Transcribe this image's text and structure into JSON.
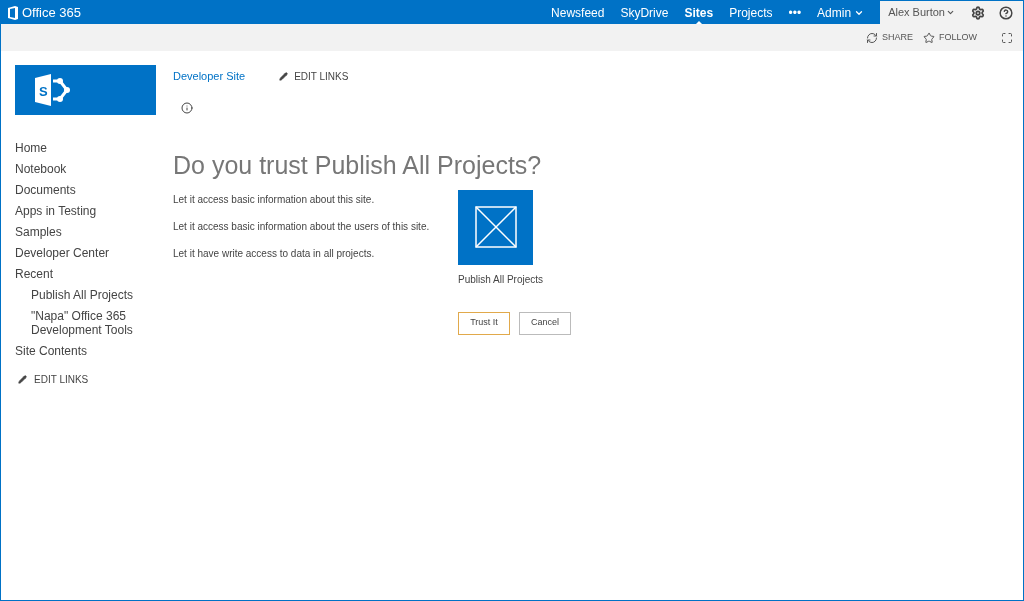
{
  "brand": "Office 365",
  "top_nav": [
    {
      "label": "Newsfeed",
      "selected": false,
      "dropdown": false
    },
    {
      "label": "SkyDrive",
      "selected": false,
      "dropdown": false
    },
    {
      "label": "Sites",
      "selected": true,
      "dropdown": false
    },
    {
      "label": "Projects",
      "selected": false,
      "dropdown": false
    },
    {
      "label": "•••",
      "selected": false,
      "dropdown": false
    },
    {
      "label": "Admin",
      "selected": false,
      "dropdown": true
    }
  ],
  "user": {
    "name": "Alex Burton"
  },
  "actions": [
    {
      "kind": "share",
      "label": "SHARE"
    },
    {
      "kind": "follow",
      "label": "FOLLOW"
    }
  ],
  "logo_letter": "S",
  "site_link": "Developer Site",
  "edit_links": "EDIT LINKS",
  "sidebar": {
    "items": [
      {
        "label": "Home"
      },
      {
        "label": "Notebook"
      },
      {
        "label": "Documents"
      },
      {
        "label": "Apps in Testing"
      },
      {
        "label": "Samples"
      },
      {
        "label": "Developer Center"
      },
      {
        "label": "Recent",
        "children": [
          {
            "label": "Publish All Projects"
          },
          {
            "label": "\"Napa\" Office 365 Development Tools"
          }
        ]
      },
      {
        "label": "Site Contents"
      }
    ],
    "edit_links": "EDIT LINKS"
  },
  "dialog": {
    "title": "Do you trust Publish All Projects?",
    "permissions": [
      "Let it access basic information about this site.",
      "Let it access basic information about the users of this site.",
      "Let it have write access to data in all projects."
    ],
    "app_name": "Publish All Projects",
    "buttons": [
      {
        "label": "Trust It",
        "selected": true
      },
      {
        "label": "Cancel",
        "selected": false
      }
    ]
  }
}
